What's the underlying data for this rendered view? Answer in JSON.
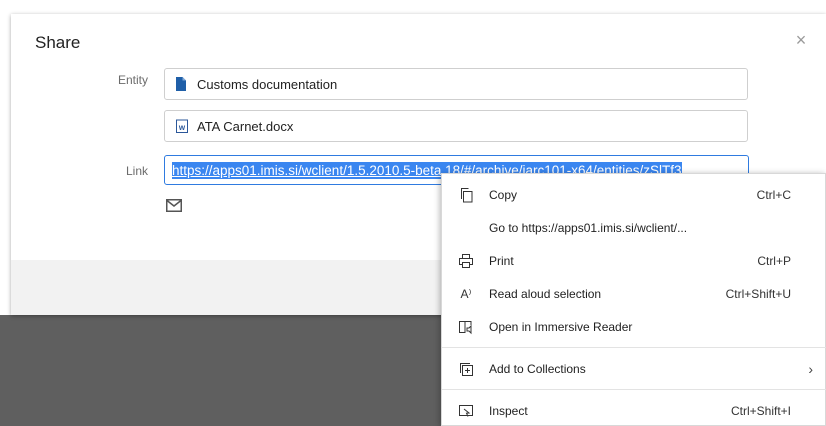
{
  "dialog": {
    "title": "Share",
    "close_glyph": "×",
    "entity_label": "Entity",
    "entity_value": "Customs documentation",
    "file_value": "ATA Carnet.docx",
    "link_label": "Link",
    "link_value": "https://apps01.imis.si/wclient/1.5.2010.5-beta.18/#/archive/iarc101-x64/entities/zSlTf3"
  },
  "context_menu": {
    "items": [
      {
        "label": "Copy",
        "shortcut": "Ctrl+C",
        "icon": "copy-icon"
      },
      {
        "label": "Go to https://apps01.imis.si/wclient/...",
        "shortcut": "",
        "icon": ""
      },
      {
        "label": "Print",
        "shortcut": "Ctrl+P",
        "icon": "print-icon"
      },
      {
        "label": "Read aloud selection",
        "shortcut": "Ctrl+Shift+U",
        "icon": "read-aloud-icon"
      },
      {
        "label": "Open in Immersive Reader",
        "shortcut": "",
        "icon": "immersive-reader-icon"
      },
      {
        "label": "Add to Collections",
        "shortcut": "",
        "icon": "collections-icon",
        "submenu": true
      },
      {
        "label": "Inspect",
        "shortcut": "Ctrl+Shift+I",
        "icon": "inspect-icon"
      }
    ],
    "submenu_glyph": "›",
    "read_aloud_glyph": "A⁾"
  },
  "colors": {
    "accent": "#2f7be0",
    "selection": "#3a86f0",
    "entity_icon": "#1f5fa8",
    "word_icon": "#2b579a"
  }
}
